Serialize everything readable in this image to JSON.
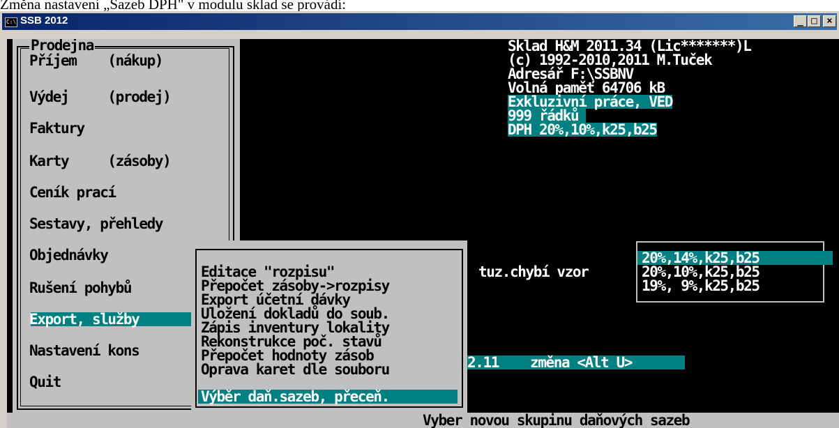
{
  "doc_text": "Změna nastavení „Sazeb DPH\" v modulu sklad se provádí:",
  "window": {
    "title": "SSB 2012",
    "sys_icon": "C:\\",
    "buttons": {
      "minimize": "_",
      "maximize": "□",
      "close": "×"
    }
  },
  "info": {
    "line1": "Sklad H&M 2011.34 (Lic*******)L",
    "line2": "(c) 1992-2010,2011 M.Tuček",
    "line3": "Adresář F:\\SSBNV",
    "line4": "Volná paměť 64706 kB",
    "line5": "Exkluzivní práce, VED",
    "line6": "999 řádků ",
    "line7": "DPH 20%,10%,k25,b25"
  },
  "main_menu": {
    "title": "Prodejna",
    "items": [
      "Příjem    (nákup)",
      "Výdej     (prodej)",
      "Faktury",
      "Karty     (zásoby)",
      "Ceník prací",
      "Sestavy, přehledy",
      "Objednávky",
      "Rušení pohybů",
      "Export, služby",
      "Nastavení kons",
      "Quit"
    ],
    "selected_index": 8
  },
  "submenu": {
    "items": [
      "Editace \"rozpisu\"",
      "Přepočet zásoby->rozpisy",
      "Export účetní dávky",
      "Uložení dokladů do soub.",
      "Zápis inventury lokality",
      "Rekonstrukce poč. stavů",
      "Přepočet hodnoty zásob",
      "Oprava karet dle souboru",
      "Výběr daň.sazeb, přeceň."
    ],
    "selected_index": 8
  },
  "background_text": {
    "tuz": "tuz.chybí vzor",
    "version_fragment": "2.11",
    "change_hint": "změna <Alt U>"
  },
  "tax_rates": {
    "options": [
      "20%,14%,k25,b25",
      "20%,10%,k25,b25",
      "19%, 9%,k25,b25"
    ],
    "selected_index": 0
  },
  "status_line": "Vyber novou skupinu daňových sazeb",
  "colors": {
    "console_bg": "#000000",
    "menu_bg": "#c0c0c0",
    "highlight": "#008080",
    "titlebar_start": "#0a246a",
    "titlebar_end": "#3a6ea5"
  }
}
